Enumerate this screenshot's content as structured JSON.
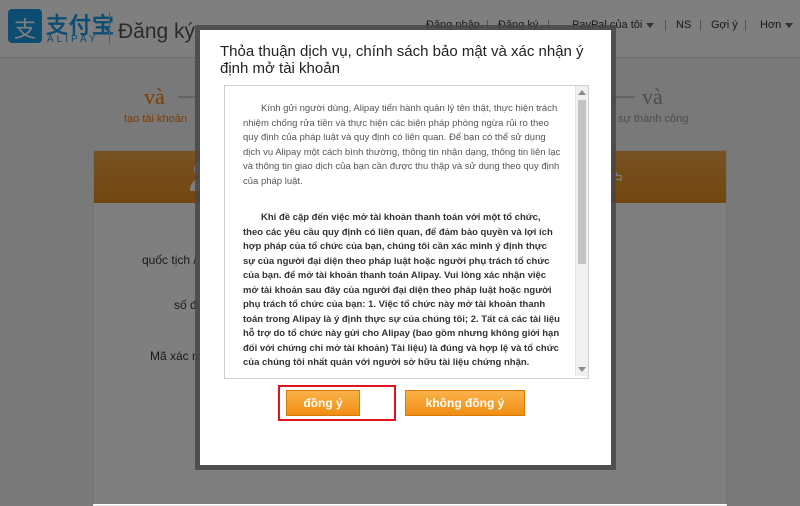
{
  "header": {
    "logo_cn": "支付宝",
    "logo_en": "ALIPAY",
    "title": "Đăng ký",
    "links": {
      "login": "Đăng nhập",
      "register": "Đăng ký",
      "paypal": "PayPal của tôi",
      "ns": "NS",
      "suggest": "Gợi ý",
      "more": "Hơn"
    }
  },
  "steps": {
    "first": {
      "num": "và",
      "label": "tạo tài khoản"
    },
    "last": {
      "num": "và",
      "label": "sự thành công"
    }
  },
  "form": {
    "header_right": "户",
    "labels": {
      "nationality": "quốc tịch / k",
      "phone": "số điệ",
      "code": "Mã xác mi"
    }
  },
  "dialog": {
    "title": "Thỏa thuận dịch vụ, chính sách bảo mật và xác nhận ý định mở tài khoản",
    "para1": "Kính gửi người dùng, Alipay tiến hành quản lý tên thật, thực hiện trách nhiệm chống rửa tiền và thực hiện các biện pháp phòng ngừa rủi ro theo quy định của pháp luật và quy định có liên quan. Để bạn có thể sử dụng dịch vụ Alipay một cách bình thường, thông tin nhận dạng, thông tin liên lạc và thông tin giao dịch của bạn cần được thu thập và sử dụng theo quy định của pháp luật.",
    "para2": "Khi đề cập đến việc mở tài khoản thanh toán với một tổ chức, theo các yêu cầu quy định có liên quan, để đảm bảo quyền và lợi ích hợp pháp của tổ chức của bạn, chúng tôi cần xác minh ý định thực sự của người đại diện theo pháp luật hoặc người phụ trách tổ chức của bạn. để mở tài khoản thanh toán Alipay. Vui lòng xác nhận việc mở tài khoản sau đây của người đại diện theo pháp luật hoặc người phụ trách tổ chức của bạn: 1. Việc tổ chức này mở tài khoản thanh toán trong Alipay là ý định thực sự của chúng tôi; 2. Tất cả các tài liệu hỗ trợ do tổ chức này gửi cho Alipay (bao gồm nhưng không giới hạn đối với chứng chỉ mở tài khoản) Tài liệu) là đúng và hợp lệ và tổ chức của chúng tôi nhất quán với người sở hữu tài liệu chứng nhận.",
    "agree": "đồng ý",
    "disagree": "không đồng ý"
  },
  "colors": {
    "accent": "#ff7a00",
    "brand": "#1a9be6",
    "highlight": "#e0121b"
  }
}
